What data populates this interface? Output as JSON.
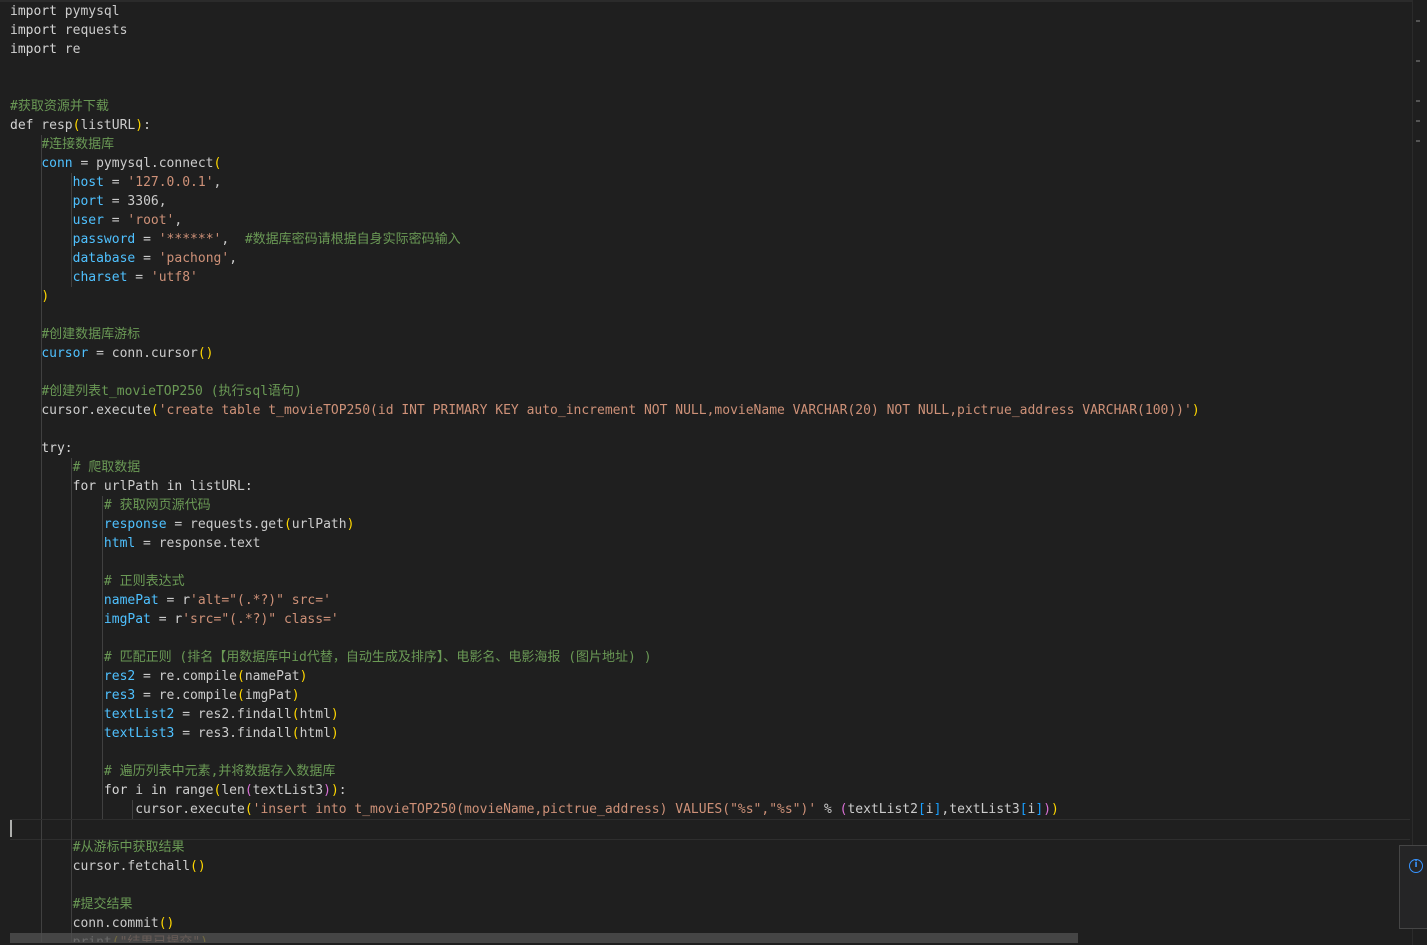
{
  "colors": {
    "background": "#1f1f1f",
    "keyword": "#d4d4d4",
    "comment": "#6a9955",
    "string": "#ce9178",
    "variable": "#4fc1ff",
    "paren_level1": "#ffd700",
    "paren_level2": "#da70d6",
    "paren_level3": "#179fff",
    "info": "#3794ff"
  },
  "editor": {
    "language": "python",
    "current_line": 43,
    "lines": [
      {
        "indent": 0,
        "tokens": [
          [
            "kw",
            "import"
          ],
          [
            "nm",
            " pymysql"
          ]
        ]
      },
      {
        "indent": 0,
        "tokens": [
          [
            "kw",
            "import"
          ],
          [
            "nm",
            " requests"
          ]
        ]
      },
      {
        "indent": 0,
        "tokens": [
          [
            "kw",
            "import"
          ],
          [
            "nm",
            " re"
          ]
        ]
      },
      {
        "indent": 0,
        "tokens": []
      },
      {
        "indent": 0,
        "tokens": []
      },
      {
        "indent": 0,
        "tokens": [
          [
            "cm",
            "#获取资源并下载"
          ]
        ]
      },
      {
        "indent": 0,
        "tokens": [
          [
            "kw",
            "def"
          ],
          [
            "nm",
            " resp"
          ],
          [
            "pa",
            "("
          ],
          [
            "nm",
            "listURL"
          ],
          [
            "pa",
            ")"
          ],
          [
            "nm",
            ":"
          ]
        ]
      },
      {
        "indent": 1,
        "tokens": [
          [
            "cm",
            "#连接数据库"
          ]
        ]
      },
      {
        "indent": 1,
        "tokens": [
          [
            "va",
            "conn"
          ],
          [
            "nm",
            " = pymysql.connect"
          ],
          [
            "pa",
            "("
          ]
        ]
      },
      {
        "indent": 2,
        "tokens": [
          [
            "va",
            "host"
          ],
          [
            "nm",
            " = "
          ],
          [
            "st",
            "'127.0.0.1'"
          ],
          [
            "nm",
            ","
          ]
        ]
      },
      {
        "indent": 2,
        "tokens": [
          [
            "va",
            "port"
          ],
          [
            "nm",
            " = 3306,"
          ]
        ]
      },
      {
        "indent": 2,
        "tokens": [
          [
            "va",
            "user"
          ],
          [
            "nm",
            " = "
          ],
          [
            "st",
            "'root'"
          ],
          [
            "nm",
            ","
          ]
        ]
      },
      {
        "indent": 2,
        "tokens": [
          [
            "va",
            "password"
          ],
          [
            "nm",
            " = "
          ],
          [
            "st",
            "'******'"
          ],
          [
            "nm",
            ",  "
          ],
          [
            "cm",
            "#数据库密码请根据自身实际密码输入"
          ]
        ]
      },
      {
        "indent": 2,
        "tokens": [
          [
            "va",
            "database"
          ],
          [
            "nm",
            " = "
          ],
          [
            "st",
            "'pachong'"
          ],
          [
            "nm",
            ","
          ]
        ]
      },
      {
        "indent": 2,
        "tokens": [
          [
            "va",
            "charset"
          ],
          [
            "nm",
            " = "
          ],
          [
            "st",
            "'utf8'"
          ]
        ]
      },
      {
        "indent": 1,
        "tokens": [
          [
            "pa",
            ")"
          ]
        ]
      },
      {
        "indent": 0,
        "tokens": []
      },
      {
        "indent": 1,
        "tokens": [
          [
            "cm",
            "#创建数据库游标"
          ]
        ]
      },
      {
        "indent": 1,
        "tokens": [
          [
            "va",
            "cursor"
          ],
          [
            "nm",
            " = conn.cursor"
          ],
          [
            "pa",
            "()"
          ]
        ]
      },
      {
        "indent": 0,
        "tokens": []
      },
      {
        "indent": 1,
        "tokens": [
          [
            "cm",
            "#创建列表t_movieTOP250 (执行sql语句)"
          ]
        ]
      },
      {
        "indent": 1,
        "tokens": [
          [
            "nm",
            "cursor.execute"
          ],
          [
            "pa",
            "("
          ],
          [
            "st",
            "'create table t_movieTOP250(id INT PRIMARY KEY auto_increment NOT NULL,movieName VARCHAR(20) NOT NULL,pictrue_address VARCHAR(100))'"
          ],
          [
            "pa",
            ")"
          ]
        ]
      },
      {
        "indent": 0,
        "tokens": []
      },
      {
        "indent": 1,
        "tokens": [
          [
            "kw",
            "try"
          ],
          [
            "nm",
            ":"
          ]
        ]
      },
      {
        "indent": 2,
        "tokens": [
          [
            "cm",
            "# 爬取数据"
          ]
        ]
      },
      {
        "indent": 2,
        "tokens": [
          [
            "kw",
            "for"
          ],
          [
            "nm",
            " urlPath "
          ],
          [
            "kw",
            "in"
          ],
          [
            "nm",
            " listURL:"
          ]
        ]
      },
      {
        "indent": 3,
        "tokens": [
          [
            "cm",
            "# 获取网页源代码"
          ]
        ]
      },
      {
        "indent": 3,
        "tokens": [
          [
            "va",
            "response"
          ],
          [
            "nm",
            " = requests.get"
          ],
          [
            "pa",
            "("
          ],
          [
            "nm",
            "urlPath"
          ],
          [
            "pa",
            ")"
          ]
        ]
      },
      {
        "indent": 3,
        "tokens": [
          [
            "va",
            "html"
          ],
          [
            "nm",
            " = response.text"
          ]
        ]
      },
      {
        "indent": 0,
        "tokens": []
      },
      {
        "indent": 3,
        "tokens": [
          [
            "cm",
            "# 正则表达式"
          ]
        ]
      },
      {
        "indent": 3,
        "tokens": [
          [
            "va",
            "namePat"
          ],
          [
            "nm",
            " = "
          ],
          [
            "kw",
            "r"
          ],
          [
            "st",
            "'alt=\"(.*?)\" src='"
          ]
        ]
      },
      {
        "indent": 3,
        "tokens": [
          [
            "va",
            "imgPat"
          ],
          [
            "nm",
            " = "
          ],
          [
            "kw",
            "r"
          ],
          [
            "st",
            "'src=\"(.*?)\" class='"
          ]
        ]
      },
      {
        "indent": 0,
        "tokens": []
      },
      {
        "indent": 3,
        "tokens": [
          [
            "cm",
            "# 匹配正则 (排名【用数据库中id代替，自动生成及排序】、电影名、电影海报 (图片地址) )"
          ]
        ]
      },
      {
        "indent": 3,
        "tokens": [
          [
            "va",
            "res2"
          ],
          [
            "nm",
            " = re.compile"
          ],
          [
            "pa",
            "("
          ],
          [
            "nm",
            "namePat"
          ],
          [
            "pa",
            ")"
          ]
        ]
      },
      {
        "indent": 3,
        "tokens": [
          [
            "va",
            "res3"
          ],
          [
            "nm",
            " = re.compile"
          ],
          [
            "pa",
            "("
          ],
          [
            "nm",
            "imgPat"
          ],
          [
            "pa",
            ")"
          ]
        ]
      },
      {
        "indent": 3,
        "tokens": [
          [
            "va",
            "textList2"
          ],
          [
            "nm",
            " = res2.findall"
          ],
          [
            "pa",
            "("
          ],
          [
            "nm",
            "html"
          ],
          [
            "pa",
            ")"
          ]
        ]
      },
      {
        "indent": 3,
        "tokens": [
          [
            "va",
            "textList3"
          ],
          [
            "nm",
            " = res3.findall"
          ],
          [
            "pa",
            "("
          ],
          [
            "nm",
            "html"
          ],
          [
            "pa",
            ")"
          ]
        ]
      },
      {
        "indent": 0,
        "tokens": []
      },
      {
        "indent": 3,
        "tokens": [
          [
            "cm",
            "# 遍历列表中元素,并将数据存入数据库"
          ]
        ]
      },
      {
        "indent": 3,
        "tokens": [
          [
            "kw",
            "for"
          ],
          [
            "nm",
            " i "
          ],
          [
            "kw",
            "in"
          ],
          [
            "nm",
            " range"
          ],
          [
            "pa",
            "("
          ],
          [
            "nm",
            "len"
          ],
          [
            "pp",
            "("
          ],
          [
            "nm",
            "textList3"
          ],
          [
            "pp",
            ")"
          ],
          [
            "pa",
            ")"
          ],
          [
            "nm",
            ":"
          ]
        ]
      },
      {
        "indent": 4,
        "tokens": [
          [
            "nm",
            "cursor.execute"
          ],
          [
            "pa",
            "("
          ],
          [
            "st",
            "'insert into t_movieTOP250(movieName,pictrue_address) VALUES(\"%s\",\"%s\")'"
          ],
          [
            "nm",
            " % "
          ],
          [
            "pp",
            "("
          ],
          [
            "nm",
            "textList2"
          ],
          [
            "pb",
            "["
          ],
          [
            "nm",
            "i"
          ],
          [
            "pb",
            "]"
          ],
          [
            "nm",
            ",textList3"
          ],
          [
            "pb",
            "["
          ],
          [
            "nm",
            "i"
          ],
          [
            "pb",
            "]"
          ],
          [
            "pp",
            ")"
          ],
          [
            "pa",
            ")"
          ]
        ]
      },
      {
        "indent": 0,
        "tokens": []
      },
      {
        "indent": 2,
        "tokens": [
          [
            "cm",
            "#从游标中获取结果"
          ]
        ]
      },
      {
        "indent": 2,
        "tokens": [
          [
            "nm",
            "cursor.fetchall"
          ],
          [
            "pa",
            "()"
          ]
        ]
      },
      {
        "indent": 0,
        "tokens": []
      },
      {
        "indent": 2,
        "tokens": [
          [
            "cm",
            "#提交结果"
          ]
        ]
      },
      {
        "indent": 2,
        "tokens": [
          [
            "nm",
            "conn.commit"
          ],
          [
            "pa",
            "()"
          ]
        ]
      },
      {
        "indent": 2,
        "tokens": [
          [
            "nm",
            "print"
          ],
          [
            "pa",
            "("
          ],
          [
            "st",
            "\"结果已提交\""
          ],
          [
            "pa",
            ")"
          ]
        ]
      }
    ]
  }
}
